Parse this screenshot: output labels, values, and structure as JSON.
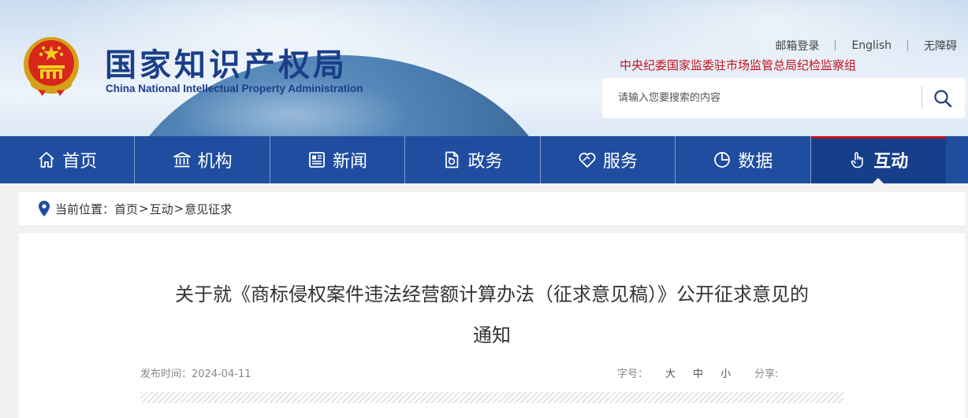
{
  "header": {
    "logo_cn": "国家知识产权局",
    "logo_en": "China National Intellectual Property Administration",
    "links": [
      {
        "label": "邮箱登录"
      },
      {
        "label": "English"
      },
      {
        "label": "无障碍"
      }
    ],
    "discipline_text": "中央纪委国家监委驻市场监管总局纪检监察组",
    "search": {
      "placeholder": "请输入您要搜索的内容",
      "value": ""
    }
  },
  "nav": {
    "items": [
      {
        "label": "首页",
        "icon": "home-icon"
      },
      {
        "label": "机构",
        "icon": "institution-icon"
      },
      {
        "label": "新闻",
        "icon": "news-icon"
      },
      {
        "label": "政务",
        "icon": "government-affairs-icon"
      },
      {
        "label": "服务",
        "icon": "service-icon"
      },
      {
        "label": "数据",
        "icon": "data-pie-icon"
      },
      {
        "label": "互动",
        "icon": "interaction-hand-icon"
      }
    ],
    "active": "互动",
    "colors": {
      "bar": "#1f4ea0",
      "active": "#163f8a",
      "active_indicator": "#c1121c"
    }
  },
  "breadcrumb": {
    "prefix": "当前位置：",
    "items": [
      "首页",
      "互动",
      "意见征求"
    ],
    "separator": ">"
  },
  "article": {
    "title_line1": "关于就《商标侵权案件违法经营额计算办法（征求意见稿）》公开征求意见的",
    "title_line2": "通知",
    "date_label": "发布时间：",
    "date": "2024-04-11",
    "font_size_label": "字号：",
    "font_sizes": [
      "大",
      "中",
      "小"
    ],
    "share_label": "分享:"
  }
}
